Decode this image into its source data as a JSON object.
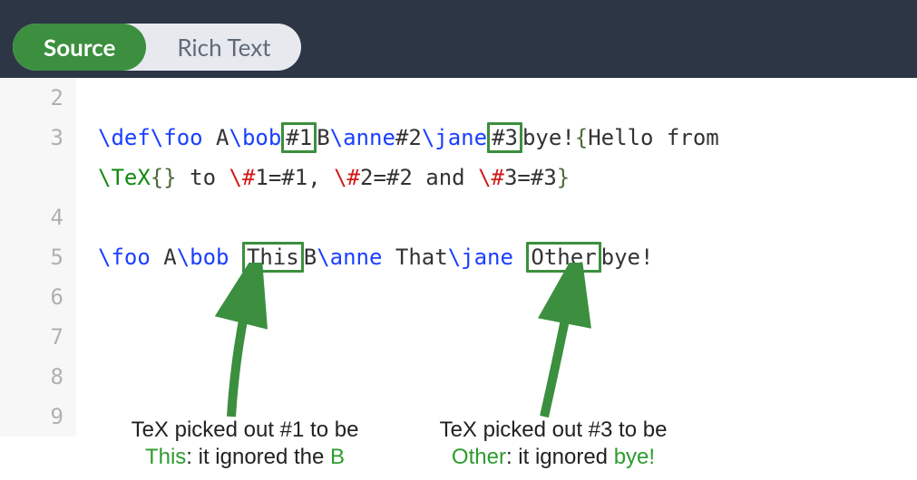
{
  "topbar": {
    "tab_source_label": "Source",
    "tab_rich_label": "Rich Text"
  },
  "gutter": {
    "n2": "2",
    "n3": "3",
    "n4": "4",
    "n5": "5",
    "n6": "6",
    "n7": "7",
    "n8": "8",
    "n9": "9"
  },
  "code": {
    "l3": {
      "def": "\\def\\foo",
      "sp1": " A",
      "bob": "\\bob",
      "p1": "#1",
      "B": "B",
      "anne": "\\anne",
      "p2": "#2",
      "jane": "\\jane",
      "p3": "#3",
      "bye": "bye!",
      "ob": "{",
      "hello": "Hello from"
    },
    "l3b": {
      "tex": "\\TeX",
      "br": "{}",
      "to": " to ",
      "h1": "\\#",
      "e1": "1=#1, ",
      "h2": "\\#",
      "e2": "2=#2 and ",
      "h3": "\\#",
      "e3": "3=#3",
      "cb": "}"
    },
    "l5": {
      "foo": "\\foo",
      "A": " A",
      "bob": "\\bob",
      "sp": " ",
      "This": "This",
      "B": "B",
      "anne": "\\anne",
      "That": " That",
      "jane": "\\jane",
      "sp2": " ",
      "Other": "Other",
      "bye": "bye!"
    }
  },
  "annot": {
    "left": {
      "t1a": "TeX picked out #1 to be",
      "t2a": "This",
      "t2b": ": it ignored the ",
      "t2c": "B"
    },
    "right": {
      "t1a": "TeX picked out #3 to be",
      "t2a": "Other",
      "t2b": ": it ignored ",
      "t2c": "bye!"
    }
  },
  "colors": {
    "tab_active_bg": "#3b8f3e",
    "topbar_bg": "#2c3645",
    "cs_blue": "#1a3fff",
    "cs_red": "#d11a1a",
    "cs_green": "#0f8a0f"
  }
}
